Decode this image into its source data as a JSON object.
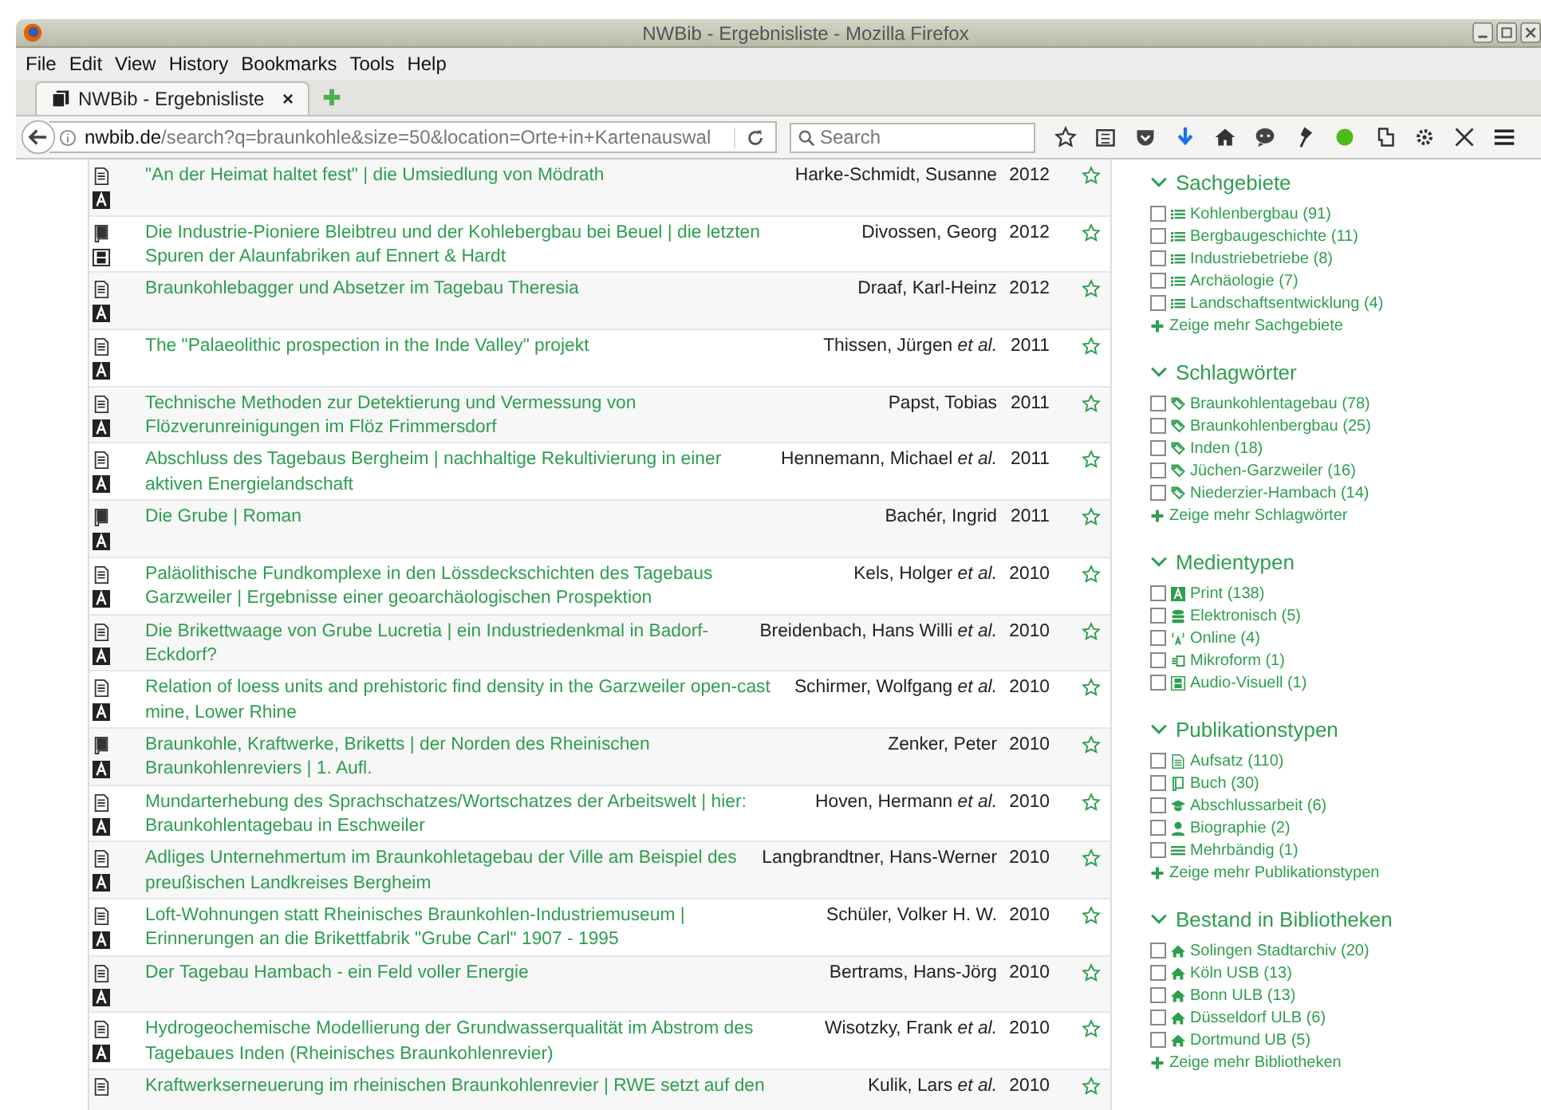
{
  "window": {
    "title": "NWBib - Ergebnisliste - Mozilla Firefox"
  },
  "menu": [
    "File",
    "Edit",
    "View",
    "History",
    "Bookmarks",
    "Tools",
    "Help"
  ],
  "tabs": [
    {
      "label": "NWBib - Ergebnisliste",
      "selected": true,
      "close": "×"
    }
  ],
  "address": {
    "host": "nwbib.de",
    "path": "/search?q=braunkohle&size=50&location=Orte+in+Kartenauswal"
  },
  "search": {
    "placeholder": "Search"
  },
  "results": [
    {
      "icons": [
        {
          "kind": "article"
        },
        {
          "kind": "print"
        }
      ],
      "title": "\"An der Heimat haltet fest\" | die Umsiedlung von Mödrath",
      "author": "Harke-Schmidt, Susanne",
      "year": "2012"
    },
    {
      "icons": [
        {
          "kind": "book"
        },
        {
          "kind": "av"
        }
      ],
      "title": "Die Industrie-Pioniere Bleibtreu und der Kohlebergbau bei Beuel | die letzten Spuren der Alaunfabriken auf Ennert & Hardt",
      "author": "Divossen, Georg",
      "year": "2012"
    },
    {
      "icons": [
        {
          "kind": "article"
        },
        {
          "kind": "print"
        }
      ],
      "title": "Braunkohlebagger und Absetzer im Tagebau Theresia",
      "author": "Draaf, Karl-Heinz",
      "year": "2012"
    },
    {
      "icons": [
        {
          "kind": "article"
        },
        {
          "kind": "print"
        }
      ],
      "title": "The \"Palaeolithic prospection in the Inde Valley\" projekt",
      "author": "Thissen, Jürgen *et al.*",
      "year": "2011"
    },
    {
      "icons": [
        {
          "kind": "article"
        },
        {
          "kind": "print"
        }
      ],
      "title": "Technische Methoden zur Detektierung und Vermessung von Flözverunreinigungen im Flöz Frimmersdorf",
      "author": "Papst, Tobias",
      "year": "2011"
    },
    {
      "icons": [
        {
          "kind": "article"
        },
        {
          "kind": "print"
        }
      ],
      "title": "Abschluss des Tagebaus Bergheim | nachhaltige Rekultivierung in einer aktiven Energielandschaft",
      "author": "Hennemann, Michael *et al.*",
      "year": "2011"
    },
    {
      "icons": [
        {
          "kind": "book"
        },
        {
          "kind": "print"
        }
      ],
      "title": "Die Grube | Roman",
      "author": "Bachér, Ingrid",
      "year": "2011"
    },
    {
      "icons": [
        {
          "kind": "article"
        },
        {
          "kind": "print"
        }
      ],
      "title": "Paläolithische Fundkomplexe in den Lössdeckschichten des Tagebaus Garzweiler | Ergebnisse einer geoarchäologischen Prospektion",
      "author": "Kels, Holger *et al.*",
      "year": "2010"
    },
    {
      "icons": [
        {
          "kind": "article"
        },
        {
          "kind": "print"
        }
      ],
      "title": "Die Brikettwaage von Grube Lucretia | ein Industriedenkmal in Badorf-Eckdorf?",
      "author": "Breidenbach, Hans Willi *et al.*",
      "year": "2010"
    },
    {
      "icons": [
        {
          "kind": "article"
        },
        {
          "kind": "print"
        }
      ],
      "title": "Relation of loess units and prehistoric find density in the Garzweiler open-cast mine, Lower Rhine",
      "author": "Schirmer, Wolfgang *et al.*",
      "year": "2010"
    },
    {
      "icons": [
        {
          "kind": "book"
        },
        {
          "kind": "print"
        }
      ],
      "title": "Braunkohle, Kraftwerke, Briketts | der Norden des Rheinischen Braunkohlenreviers | 1. Aufl.",
      "author": "Zenker, Peter",
      "year": "2010"
    },
    {
      "icons": [
        {
          "kind": "article"
        },
        {
          "kind": "print"
        }
      ],
      "title": "Mundarterhebung des Sprachschatzes/Wortschatzes der Arbeitswelt | hier: Braunkohlentagebau in Eschweiler",
      "author": "Hoven, Hermann *et al.*",
      "year": "2010"
    },
    {
      "icons": [
        {
          "kind": "article"
        },
        {
          "kind": "print"
        }
      ],
      "title": "Adliges Unternehmertum im Braunkohletagebau der Ville am Beispiel des preußischen Landkreises Bergheim",
      "author": "Langbrandtner, Hans-Werner",
      "year": "2010"
    },
    {
      "icons": [
        {
          "kind": "article"
        },
        {
          "kind": "print"
        }
      ],
      "title": "Loft-Wohnungen statt Rheinisches Braunkohlen-Industriemuseum | Erinnerungen an die Brikettfabrik \"Grube Carl\" 1907 - 1995",
      "author": "Schüler, Volker H. W.",
      "year": "2010"
    },
    {
      "icons": [
        {
          "kind": "article"
        },
        {
          "kind": "print"
        }
      ],
      "title": "Der Tagebau Hambach - ein Feld voller Energie",
      "author": "Bertrams, Hans-Jörg",
      "year": "2010"
    },
    {
      "icons": [
        {
          "kind": "article"
        },
        {
          "kind": "print"
        }
      ],
      "title": "Hydrogeochemische Modellierung der Grundwasserqualität im Abstrom des Tagebaues Inden (Rheinisches Braunkohlenrevier)",
      "author": "Wisotzky, Frank *et al.*",
      "year": "2010"
    },
    {
      "icons": [
        {
          "kind": "article"
        }
      ],
      "title": "Kraftwerkserneuerung im rheinischen Braunkohlenrevier | RWE setzt auf den",
      "author": "Kulik, Lars *et al.*",
      "year": "2010"
    }
  ],
  "facets": [
    {
      "heading": "Sachgebiete",
      "items": [
        {
          "kind": "list",
          "label": "Kohlenbergbau (91)",
          "checked": false
        },
        {
          "kind": "list",
          "label": "Bergbaugeschichte (11)",
          "checked": false
        },
        {
          "kind": "list",
          "label": "Industriebetriebe (8)",
          "checked": false
        },
        {
          "kind": "list",
          "label": "Archäologie (7)",
          "checked": false
        },
        {
          "kind": "list",
          "label": "Landschaftsentwicklung (4)",
          "checked": false
        }
      ],
      "more": "Zeige mehr Sachgebiete"
    },
    {
      "heading": "Schlagwörter",
      "items": [
        {
          "kind": "tag",
          "label": "Braunkohlentagebau (78)",
          "checked": false
        },
        {
          "kind": "tag",
          "label": "Braunkohlenbergbau (25)",
          "checked": false
        },
        {
          "kind": "tag",
          "label": "Inden (18)",
          "checked": false
        },
        {
          "kind": "tag",
          "label": "Jüchen-Garzweiler (16)",
          "checked": false
        },
        {
          "kind": "tag",
          "label": "Niederzier-Hambach (14)",
          "checked": false
        }
      ],
      "more": "Zeige mehr Schlagwörter"
    },
    {
      "heading": "Medientypen",
      "items": [
        {
          "kind": "print",
          "label": "Print (138)",
          "checked": false
        },
        {
          "kind": "electronic",
          "label": "Elektronisch (5)",
          "checked": false
        },
        {
          "kind": "online",
          "label": "Online (4)",
          "checked": false
        },
        {
          "kind": "microform",
          "label": "Mikroform (1)",
          "checked": false
        },
        {
          "kind": "av",
          "label": "Audio-Visuell (1)",
          "checked": false
        }
      ]
    },
    {
      "heading": "Publikationstypen",
      "items": [
        {
          "kind": "article",
          "label": "Aufsatz (110)",
          "checked": false
        },
        {
          "kind": "book",
          "label": "Buch (30)",
          "checked": false
        },
        {
          "kind": "thesis",
          "label": "Abschlussarbeit (6)",
          "checked": false
        },
        {
          "kind": "person",
          "label": "Biographie (2)",
          "checked": false
        },
        {
          "kind": "multi",
          "label": "Mehrbändig (1)",
          "checked": false
        }
      ],
      "more": "Zeige mehr Publikationstypen"
    },
    {
      "heading": "Bestand in Bibliotheken",
      "items": [
        {
          "kind": "home",
          "label": "Solingen Stadtarchiv (20)",
          "checked": false
        },
        {
          "kind": "home",
          "label": "Köln USB (13)",
          "checked": false
        },
        {
          "kind": "home",
          "label": "Bonn ULB (13)",
          "checked": false
        },
        {
          "kind": "home",
          "label": "Düsseldorf ULB (6)",
          "checked": false
        },
        {
          "kind": "home",
          "label": "Dortmund UB (5)",
          "checked": false
        }
      ],
      "more": "Zeige mehr Bibliotheken"
    }
  ]
}
